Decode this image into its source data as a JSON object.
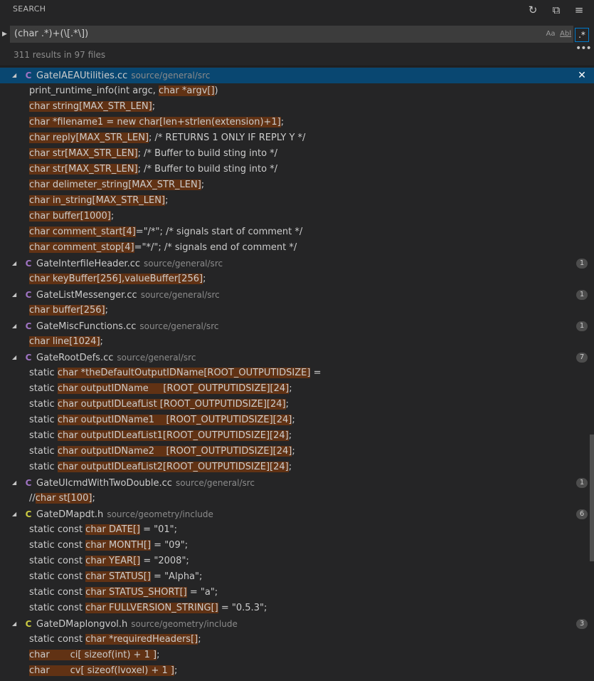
{
  "header": {
    "title": "SEARCH",
    "refresh_icon": "refresh-icon",
    "collapse_icon": "collapse-all-icon",
    "clear_icon": "clear-results-icon"
  },
  "search": {
    "query": "(char .*)+(\\[.*\\])",
    "match_case_label": "Aa",
    "whole_word_label": "Abl",
    "regex_icon": "regex-icon",
    "more_icon": "ellipsis-icon"
  },
  "summary": "311 results in 97 files",
  "colors": {
    "selection": "#094771",
    "match_highlight": "#613214",
    "cc_icon": "#a074c4",
    "h_icon": "#cbcb41"
  },
  "files": [
    {
      "name": "GateIAEAUtilities.cc",
      "path": "source/general/src",
      "icon": "C",
      "kind": "cc",
      "selected": true,
      "count": "",
      "matches": [
        {
          "pre": "print_runtime_info(int argc, ",
          "hl": "char *argv[]",
          "post": ")"
        },
        {
          "pre": "",
          "hl": "char string[MAX_STR_LEN]",
          "post": ";"
        },
        {
          "pre": "",
          "hl": "char *filename1 = new char[len+strlen(extension)+1]",
          "post": ";"
        },
        {
          "pre": "",
          "hl": "char reply[MAX_STR_LEN]",
          "post": "; /* RETURNS 1 ONLY IF REPLY Y */"
        },
        {
          "pre": "",
          "hl": "char str[MAX_STR_LEN]",
          "post": "; /* Buffer to build sting into */"
        },
        {
          "pre": "",
          "hl": "char str[MAX_STR_LEN]",
          "post": "; /* Buffer to build sting into */"
        },
        {
          "pre": "",
          "hl": "char delimeter_string[MAX_STR_LEN]",
          "post": ";"
        },
        {
          "pre": "",
          "hl": "char in_string[MAX_STR_LEN]",
          "post": ";"
        },
        {
          "pre": "",
          "hl": "char buffer[1000]",
          "post": ";"
        },
        {
          "pre": "",
          "hl": "char comment_start[4]",
          "post": "=\"/*\"; /* signals start of comment */"
        },
        {
          "pre": "",
          "hl": "char comment_stop[4]",
          "post": "=\"*/\"; /* signals end of comment */"
        }
      ]
    },
    {
      "name": "GateInterfileHeader.cc",
      "path": "source/general/src",
      "icon": "C",
      "kind": "cc",
      "selected": false,
      "count": "1",
      "matches": [
        {
          "pre": "",
          "hl": "char keyBuffer[256],valueBuffer[256]",
          "post": ";"
        }
      ]
    },
    {
      "name": "GateListMessenger.cc",
      "path": "source/general/src",
      "icon": "C",
      "kind": "cc",
      "selected": false,
      "count": "1",
      "matches": [
        {
          "pre": "",
          "hl": "char buffer[256]",
          "post": ";"
        }
      ]
    },
    {
      "name": "GateMiscFunctions.cc",
      "path": "source/general/src",
      "icon": "C",
      "kind": "cc",
      "selected": false,
      "count": "1",
      "matches": [
        {
          "pre": "",
          "hl": "char line[1024]",
          "post": ";"
        }
      ]
    },
    {
      "name": "GateRootDefs.cc",
      "path": "source/general/src",
      "icon": "C",
      "kind": "cc",
      "selected": false,
      "count": "7",
      "matches": [
        {
          "pre": "static ",
          "hl": "char *theDefaultOutputIDName[ROOT_OUTPUTIDSIZE]",
          "post": " ="
        },
        {
          "pre": "static ",
          "hl": "char outputIDName     [ROOT_OUTPUTIDSIZE][24]",
          "post": ";"
        },
        {
          "pre": "static ",
          "hl": "char outputIDLeafList [ROOT_OUTPUTIDSIZE][24]",
          "post": ";"
        },
        {
          "pre": "static ",
          "hl": "char outputIDName1    [ROOT_OUTPUTIDSIZE][24]",
          "post": ";"
        },
        {
          "pre": "static ",
          "hl": "char outputIDLeafList1[ROOT_OUTPUTIDSIZE][24]",
          "post": ";"
        },
        {
          "pre": "static ",
          "hl": "char outputIDName2    [ROOT_OUTPUTIDSIZE][24]",
          "post": ";"
        },
        {
          "pre": "static ",
          "hl": "char outputIDLeafList2[ROOT_OUTPUTIDSIZE][24]",
          "post": ";"
        }
      ]
    },
    {
      "name": "GateUIcmdWithTwoDouble.cc",
      "path": "source/general/src",
      "icon": "C",
      "kind": "cc",
      "selected": false,
      "count": "1",
      "matches": [
        {
          "pre": "//",
          "hl": "char st[100]",
          "post": ";"
        }
      ]
    },
    {
      "name": "GateDMapdt.h",
      "path": "source/geometry/include",
      "icon": "C",
      "kind": "h",
      "selected": false,
      "count": "6",
      "matches": [
        {
          "pre": "static const ",
          "hl": "char DATE[]",
          "post": " = \"01\";"
        },
        {
          "pre": "static const ",
          "hl": "char MONTH[]",
          "post": " = \"09\";"
        },
        {
          "pre": "static const ",
          "hl": "char YEAR[]",
          "post": " = \"2008\";"
        },
        {
          "pre": "static const ",
          "hl": "char STATUS[]",
          "post": " = \"Alpha\";"
        },
        {
          "pre": "static const ",
          "hl": "char STATUS_SHORT[]",
          "post": " = \"a\";"
        },
        {
          "pre": "static const ",
          "hl": "char FULLVERSION_STRING[]",
          "post": " = \"0.5.3\";"
        }
      ]
    },
    {
      "name": "GateDMaplongvol.h",
      "path": "source/geometry/include",
      "icon": "C",
      "kind": "h",
      "selected": false,
      "count": "3",
      "matches": [
        {
          "pre": "static const ",
          "hl": "char *requiredHeaders[]",
          "post": ";"
        },
        {
          "pre": "",
          "hl": "char       ci[ sizeof(int) + 1 ]",
          "post": ";"
        },
        {
          "pre": "",
          "hl": "char       cv[ sizeof(lvoxel) + 1 ]",
          "post": ";"
        }
      ]
    }
  ]
}
